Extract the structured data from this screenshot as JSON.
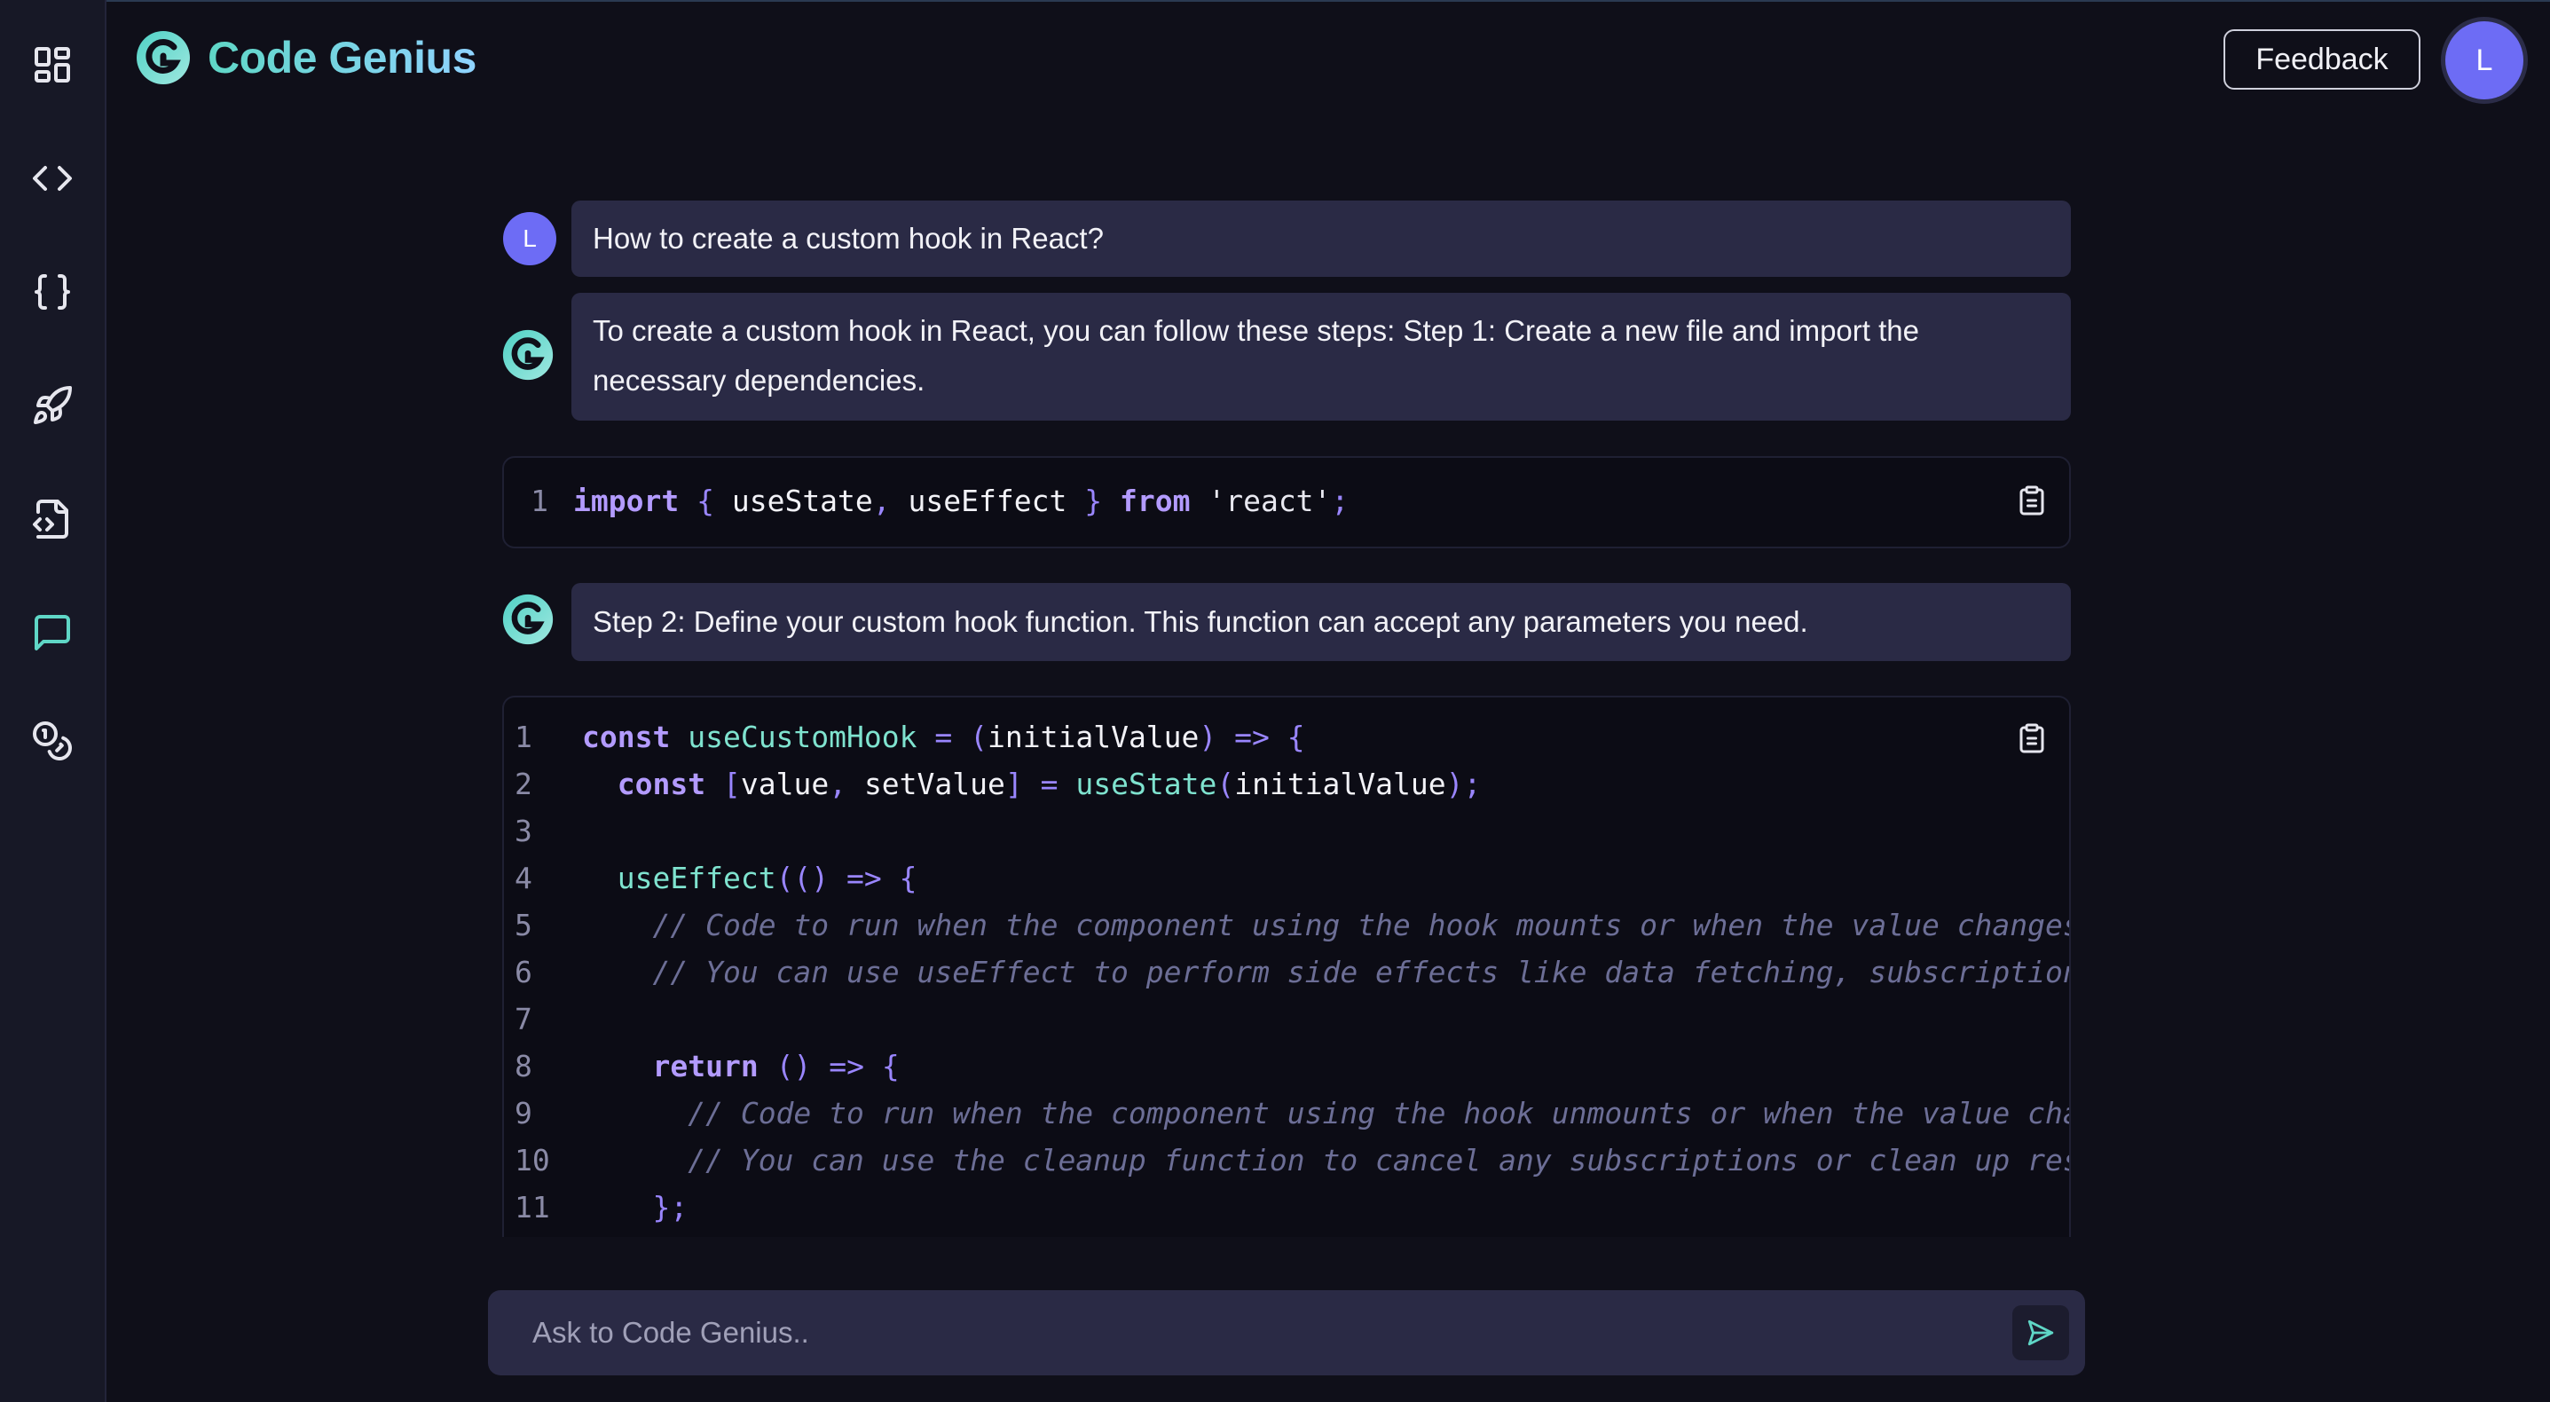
{
  "app": {
    "name": "Code Genius",
    "feedback_label": "Feedback",
    "user_initial": "L",
    "accent": "#6d6cf5",
    "brand": "#5fd6c6"
  },
  "sidebar": {
    "items": [
      {
        "icon": "dashboard-icon",
        "active": false
      },
      {
        "icon": "code-icon",
        "active": false
      },
      {
        "icon": "braces-icon",
        "active": false
      },
      {
        "icon": "rocket-icon",
        "active": false
      },
      {
        "icon": "code-file-icon",
        "active": false
      },
      {
        "icon": "chat-icon",
        "active": true
      },
      {
        "icon": "coins-icon",
        "active": false
      }
    ]
  },
  "chat": {
    "question": "How to create a custom hook in React?",
    "answer_step1": "To create a custom hook in React, you can follow these steps: Step 1: Create a new file and import the necessary dependencies.",
    "answer_step2": "Step 2: Define your custom hook function. This function can accept any parameters you need.",
    "code1": {
      "numbers": [
        "1"
      ]
    },
    "code2": {
      "numbers": [
        "1",
        "2",
        "3",
        "4",
        "5",
        "6",
        "7",
        "8",
        "9",
        "10",
        "11"
      ]
    }
  },
  "input": {
    "placeholder": "Ask to Code Genius.."
  }
}
